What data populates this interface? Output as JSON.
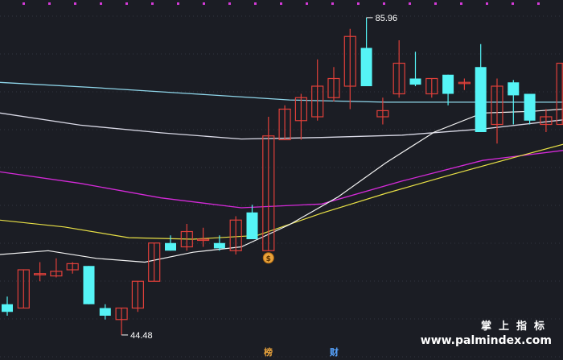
{
  "colors": {
    "background": "#1b1d24",
    "grid": "#3b3e48",
    "up": "#e0403a",
    "down": "#55f4f6",
    "ma_lightblue": "#8fd6ea",
    "ma_white": "#d9d9e6",
    "ma_magenta": "#d42ad8",
    "ma_yellow": "#e8e046",
    "ma_fast": "#f2f2f2",
    "marker_top": "#d43ad8"
  },
  "icons": {
    "moneybag": "moneybag-icon"
  },
  "watermark": {
    "chinese": "掌上指标",
    "url": "www.palmindex.com"
  },
  "tags": {
    "bang": "榜",
    "cai": "财"
  },
  "chart_data": {
    "type": "candlestick",
    "high_label": "85.96",
    "low_label": "44.48",
    "price_range": [
      43,
      87
    ],
    "candles": [
      {
        "o": 48.5,
        "c": 47.5,
        "h": 49.5,
        "l": 47.0
      },
      {
        "o": 48.0,
        "c": 53.0,
        "h": 53.0,
        "l": 48.0
      },
      {
        "o": 52.5,
        "c": 52.5,
        "h": 54.0,
        "l": 51.5
      },
      {
        "o": 52.2,
        "c": 52.8,
        "h": 54.5,
        "l": 52.0
      },
      {
        "o": 53.0,
        "c": 53.8,
        "h": 54.0,
        "l": 52.5
      },
      {
        "o": 53.5,
        "c": 48.5,
        "h": 53.5,
        "l": 48.5
      },
      {
        "o": 48.0,
        "c": 47.0,
        "h": 48.5,
        "l": 46.5
      },
      {
        "o": 46.5,
        "c": 48.0,
        "h": 48.0,
        "l": 44.48
      },
      {
        "o": 48.0,
        "c": 51.5,
        "h": 51.5,
        "l": 47.5
      },
      {
        "o": 51.5,
        "c": 56.5,
        "h": 56.5,
        "l": 51.5
      },
      {
        "o": 56.5,
        "c": 55.5,
        "h": 57.5,
        "l": 55.5
      },
      {
        "o": 56.0,
        "c": 58.0,
        "h": 59.0,
        "l": 55.5
      },
      {
        "o": 57.0,
        "c": 57.0,
        "h": 58.5,
        "l": 56.0
      },
      {
        "o": 56.5,
        "c": 55.8,
        "h": 57.5,
        "l": 55.5
      },
      {
        "o": 55.5,
        "c": 59.5,
        "h": 60.0,
        "l": 55.0
      },
      {
        "o": 60.5,
        "c": 57.0,
        "h": 61.5,
        "l": 57.0
      },
      {
        "o": 55.5,
        "c": 70.5,
        "h": 73.0,
        "l": 55.5
      },
      {
        "o": 70.0,
        "c": 74.0,
        "h": 74.5,
        "l": 70.0
      },
      {
        "o": 72.5,
        "c": 75.5,
        "h": 76.0,
        "l": 70.0
      },
      {
        "o": 73.0,
        "c": 77.0,
        "h": 80.5,
        "l": 72.5
      },
      {
        "o": 75.5,
        "c": 78.0,
        "h": 79.5,
        "l": 75.0
      },
      {
        "o": 77.0,
        "c": 83.5,
        "h": 84.5,
        "l": 74.0
      },
      {
        "o": 82.0,
        "c": 77.0,
        "h": 85.96,
        "l": 77.0
      },
      {
        "o": 73.0,
        "c": 73.8,
        "h": 75.5,
        "l": 72.0
      },
      {
        "o": 76.0,
        "c": 80.0,
        "h": 83.0,
        "l": 75.5
      },
      {
        "o": 78.0,
        "c": 77.2,
        "h": 81.5,
        "l": 77.0
      },
      {
        "o": 76.0,
        "c": 78.0,
        "h": 78.0,
        "l": 75.5
      },
      {
        "o": 78.5,
        "c": 76.0,
        "h": 78.5,
        "l": 74.5
      },
      {
        "o": 77.5,
        "c": 77.5,
        "h": 78.0,
        "l": 76.5
      },
      {
        "o": 79.5,
        "c": 71.0,
        "h": 82.5,
        "l": 71.0
      },
      {
        "o": 72.0,
        "c": 77.0,
        "h": 78.0,
        "l": 69.5
      },
      {
        "o": 77.5,
        "c": 75.8,
        "h": 77.8,
        "l": 72.0
      },
      {
        "o": 76.0,
        "c": 72.5,
        "h": 76.0,
        "l": 72.0
      },
      {
        "o": 72.0,
        "c": 73.0,
        "h": 74.0,
        "l": 71.0
      },
      {
        "o": 72.0,
        "c": 80.0,
        "h": 80.0,
        "l": 72.0
      }
    ],
    "ma": [
      {
        "color": "ma_lightblue",
        "width": 1.3,
        "x": [
          0,
          120,
          240,
          360,
          480,
          600,
          700
        ],
        "y": [
          77.5,
          76.8,
          76.0,
          75.2,
          74.9,
          74.9,
          74.9
        ]
      },
      {
        "color": "ma_white",
        "width": 1.3,
        "x": [
          0,
          100,
          200,
          300,
          400,
          500,
          600,
          700
        ],
        "y": [
          73.5,
          71.9,
          70.9,
          70.1,
          70.3,
          70.6,
          71.4,
          72.6
        ]
      },
      {
        "color": "ma_magenta",
        "width": 1.3,
        "x": [
          0,
          100,
          200,
          300,
          400,
          500,
          600,
          700
        ],
        "y": [
          65.8,
          64.3,
          62.4,
          61.1,
          61.6,
          64.6,
          67.3,
          68.6
        ]
      },
      {
        "color": "ma_yellow",
        "width": 1.2,
        "x": [
          0,
          80,
          160,
          240,
          320,
          400,
          480,
          560,
          640,
          700
        ],
        "y": [
          59.5,
          58.6,
          57.2,
          57.0,
          57.5,
          60.4,
          63.0,
          65.4,
          67.7,
          69.4
        ]
      },
      {
        "color": "ma_fast",
        "width": 1.2,
        "x": [
          0,
          60,
          120,
          180,
          240,
          300,
          360,
          420,
          480,
          540,
          600,
          660,
          700
        ],
        "y": [
          55.0,
          55.5,
          54.5,
          54.0,
          55.3,
          56.0,
          58.9,
          62.5,
          67.0,
          71.0,
          73.5,
          73.7,
          74.0
        ]
      }
    ]
  }
}
